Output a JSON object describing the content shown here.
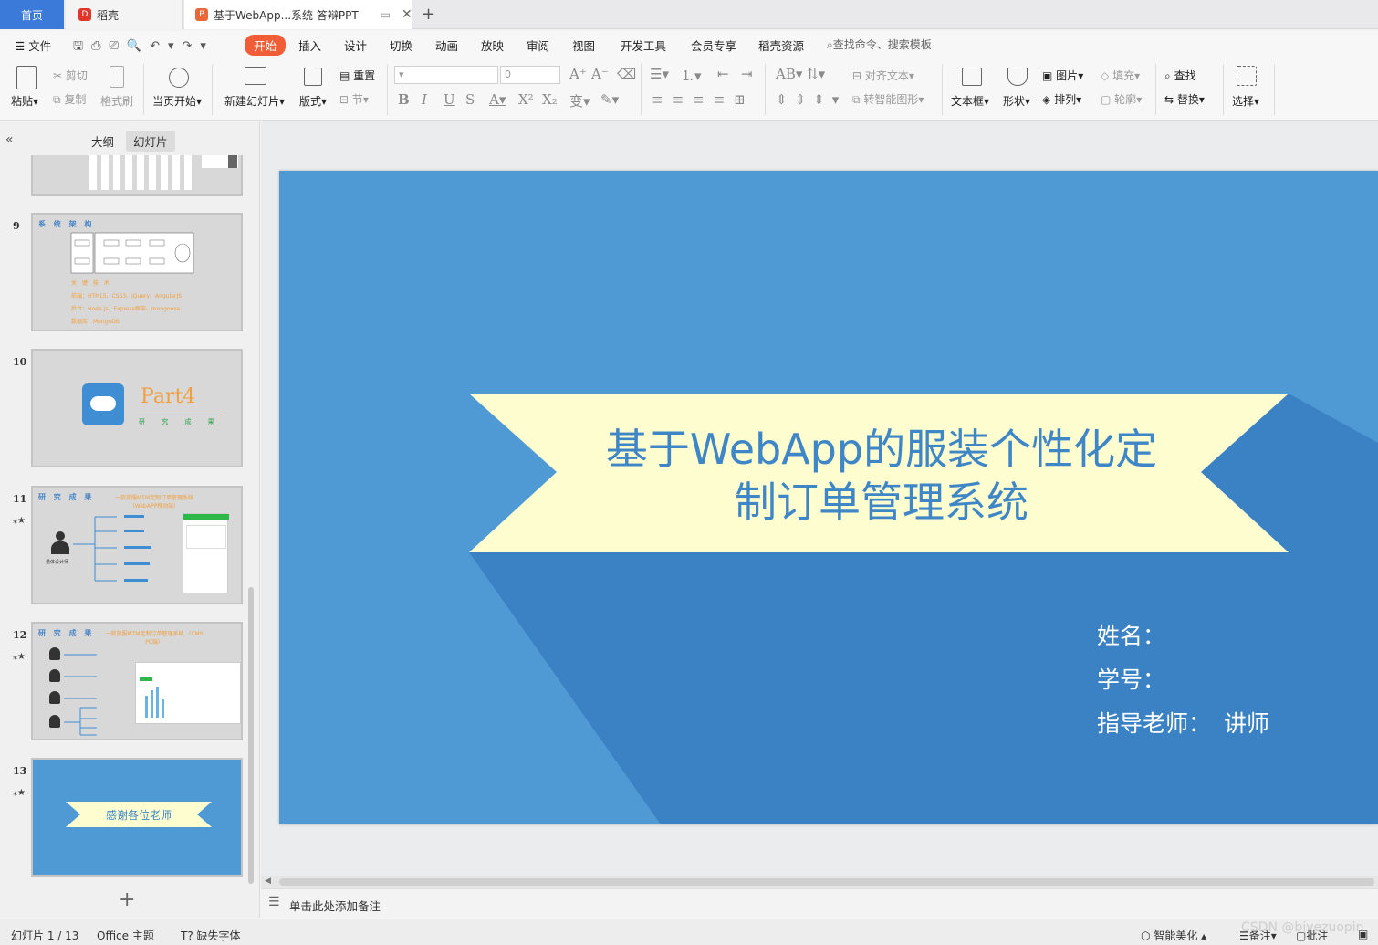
{
  "tabs": {
    "home": "首页",
    "daoke": "稻壳",
    "doc": "基于WebApp...系统 答辩PPT"
  },
  "menu": {
    "file": "文件",
    "items": [
      "开始",
      "插入",
      "设计",
      "切换",
      "动画",
      "放映",
      "审阅",
      "视图",
      "开发工具",
      "会员专享",
      "稻壳资源"
    ],
    "search": "查找命令、搜索模板"
  },
  "ribbon": {
    "paste": "粘贴",
    "cut": "剪切",
    "copy": "复制",
    "format_painter": "格式刷",
    "from_start": "当页开始",
    "new_slide": "新建幻灯片",
    "layout": "版式",
    "reset": "重置",
    "section": "节",
    "font_size": "0",
    "align_text": "对齐文本",
    "smart_shape": "转智能图形",
    "textbox": "文本框",
    "shape": "形状",
    "picture": "图片",
    "arrange": "排列",
    "fill": "填充",
    "outline": "轮廓",
    "find": "查找",
    "replace": "替换",
    "select": "选择"
  },
  "left_panel": {
    "outline_tab": "大纲",
    "slides_tab": "幻灯片",
    "thumbs": [
      {
        "num": "9",
        "title": "系 统 架 构",
        "sub": "关 键 技 术",
        "lines": [
          "前端：HTML5、CSS3、jQuery、AngularJS",
          "后台：Node.js、Express框架、mongoose",
          "数据库：MongoDB"
        ]
      },
      {
        "num": "10",
        "part": "Part4",
        "sub": "研 究 成 果"
      },
      {
        "num": "11",
        "title": "研 究 成 果",
        "subtitle": "一款旅服MTM定制订单管理系统 （WebAPP移动端）",
        "person": "量体设计师"
      },
      {
        "num": "12",
        "title": "研 究 成 果",
        "subtitle": "一款旅服MTM定制订单管理系统 （CMS PC端）"
      },
      {
        "num": "13",
        "banner": "感谢各位老师"
      }
    ]
  },
  "slide": {
    "title": "基于WebApp的服装个性化定制订单管理系统",
    "title_line1": "基于WebApp的服装个性化定",
    "title_line2": "制订单管理系统",
    "name_label": "姓名：",
    "id_label": "学号：",
    "advisor_label": "指导老师：",
    "advisor_value": "讲师",
    "colors": {
      "background": "#4f9ad5",
      "banner": "#fdfdd0",
      "fold": "#3a82c3",
      "title": "#3e86c6"
    }
  },
  "notes_placeholder": "单击此处添加备注",
  "status": {
    "slide_counter": "幻灯片 1 / 13",
    "theme": "Office 主题",
    "missing_font": "缺失字体",
    "beautify": "智能美化",
    "notes": "备注",
    "comments": "批注"
  },
  "watermark": "CSDN @biyezuopin"
}
